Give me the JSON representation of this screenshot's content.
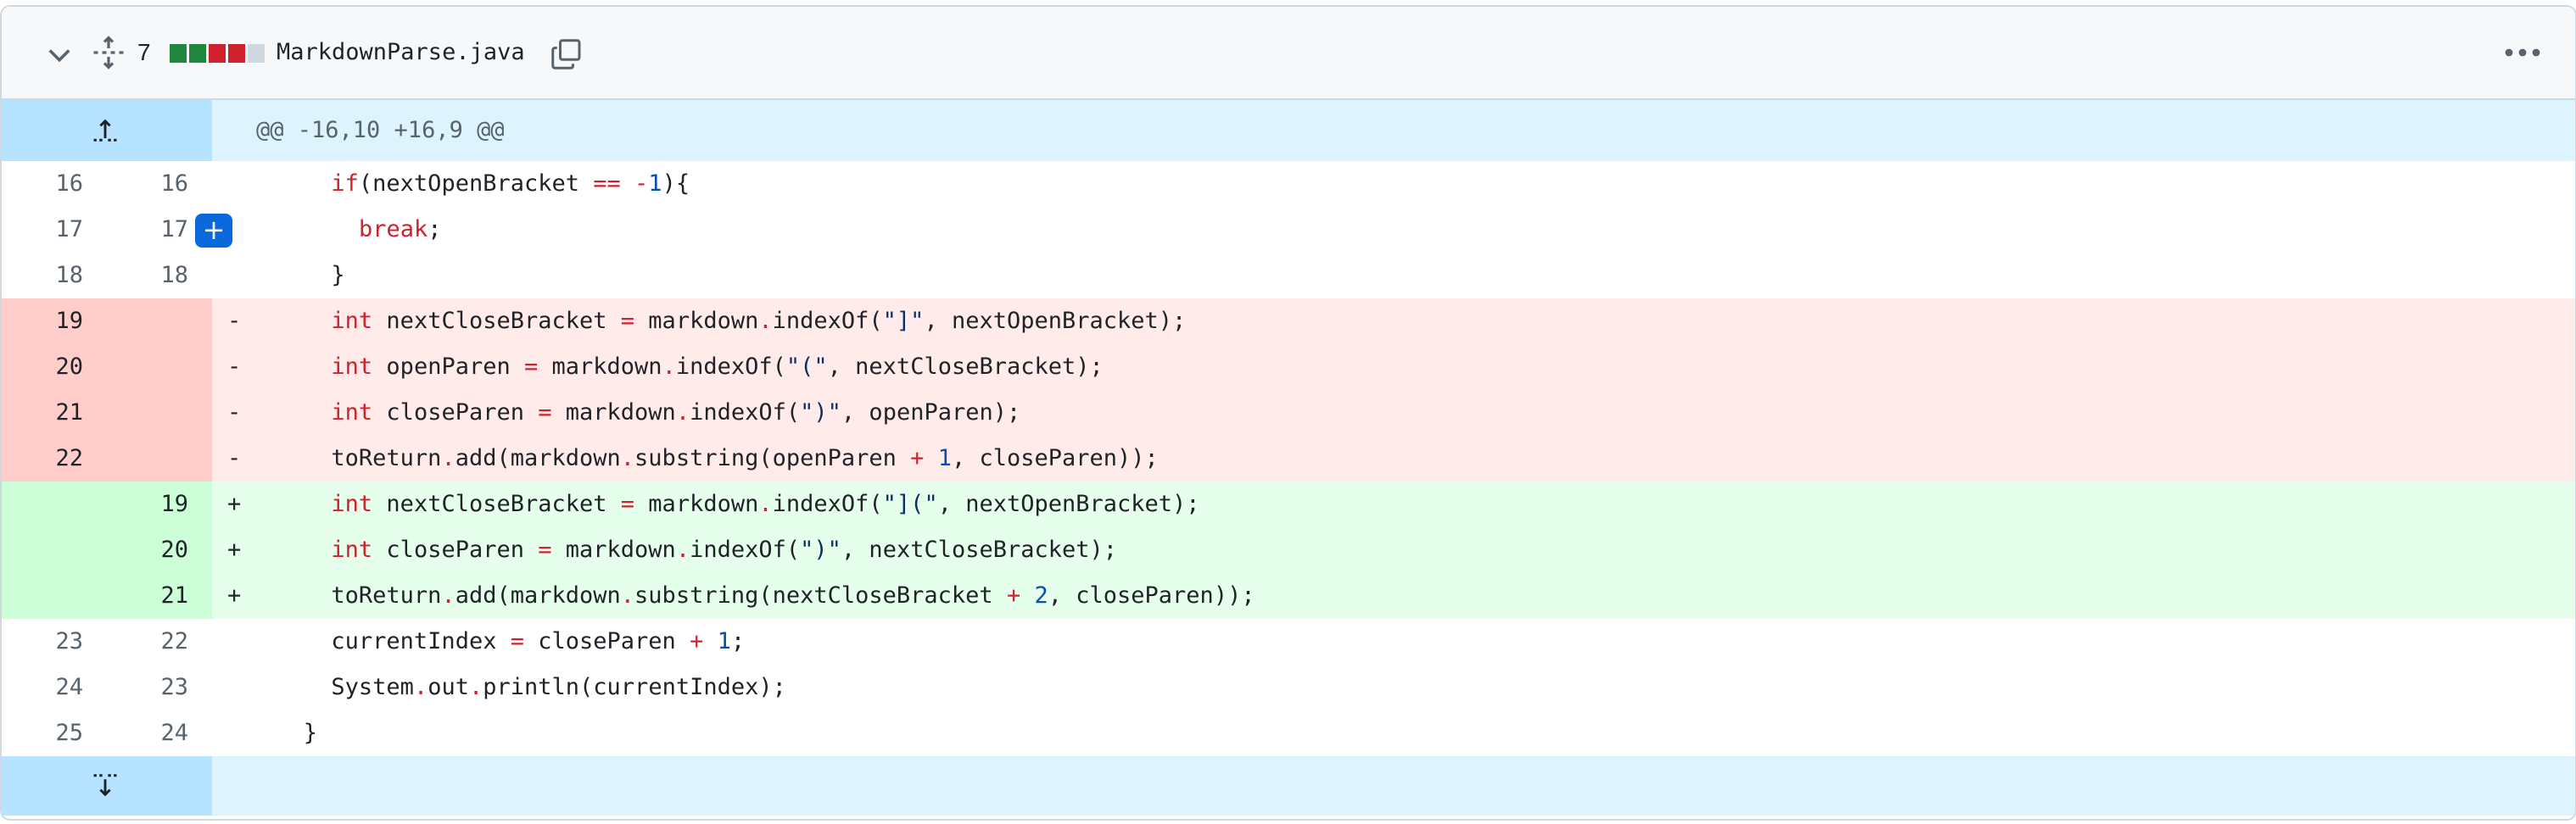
{
  "file": {
    "name": "MarkdownParse.java",
    "changes_count": "7",
    "diffstat": {
      "additions": 2,
      "deletions": 2,
      "neutral": 1
    },
    "colors": {
      "add": "#1f883d",
      "del": "#cf222e",
      "neutral": "#d1d9e0"
    },
    "icons": [
      "chevron-down-icon",
      "unfold-icon",
      "copy-icon",
      "kebab-horizontal-icon"
    ]
  },
  "hunk": {
    "header": "@@ -16,10 +16,9 @@"
  },
  "lines": [
    {
      "type": "ctx",
      "old": "16",
      "new": "16",
      "sign": "",
      "indent": 8,
      "code": "if(nextOpenBracket == -1){"
    },
    {
      "type": "ctx",
      "old": "17",
      "new": "17",
      "sign": "",
      "indent": 10,
      "code": "break;"
    },
    {
      "type": "ctx",
      "old": "18",
      "new": "18",
      "sign": "",
      "indent": 8,
      "code": "}"
    },
    {
      "type": "del",
      "old": "19",
      "new": "",
      "sign": "-",
      "indent": 8,
      "code": "int nextCloseBracket = markdown.indexOf(\"]\", nextOpenBracket);"
    },
    {
      "type": "del",
      "old": "20",
      "new": "",
      "sign": "-",
      "indent": 8,
      "code": "int openParen = markdown.indexOf(\"(\", nextCloseBracket);"
    },
    {
      "type": "del",
      "old": "21",
      "new": "",
      "sign": "-",
      "indent": 8,
      "code": "int closeParen = markdown.indexOf(\")\", openParen);"
    },
    {
      "type": "del",
      "old": "22",
      "new": "",
      "sign": "-",
      "indent": 8,
      "code": "toReturn.add(markdown.substring(openParen + 1, closeParen));"
    },
    {
      "type": "add",
      "old": "",
      "new": "19",
      "sign": "+",
      "indent": 8,
      "code": "int nextCloseBracket = markdown.indexOf(\"](\", nextOpenBracket);"
    },
    {
      "type": "add",
      "old": "",
      "new": "20",
      "sign": "+",
      "indent": 8,
      "code": "int closeParen = markdown.indexOf(\")\", nextCloseBracket);"
    },
    {
      "type": "add",
      "old": "",
      "new": "21",
      "sign": "+",
      "indent": 8,
      "code": "toReturn.add(markdown.substring(nextCloseBracket + 2, closeParen));"
    },
    {
      "type": "ctx",
      "old": "23",
      "new": "22",
      "sign": "",
      "indent": 8,
      "code": "currentIndex = closeParen + 1;"
    },
    {
      "type": "ctx",
      "old": "24",
      "new": "23",
      "sign": "",
      "indent": 8,
      "code": "System.out.println(currentIndex);"
    },
    {
      "type": "ctx",
      "old": "25",
      "new": "24",
      "sign": "",
      "indent": 6,
      "code": "}"
    }
  ]
}
